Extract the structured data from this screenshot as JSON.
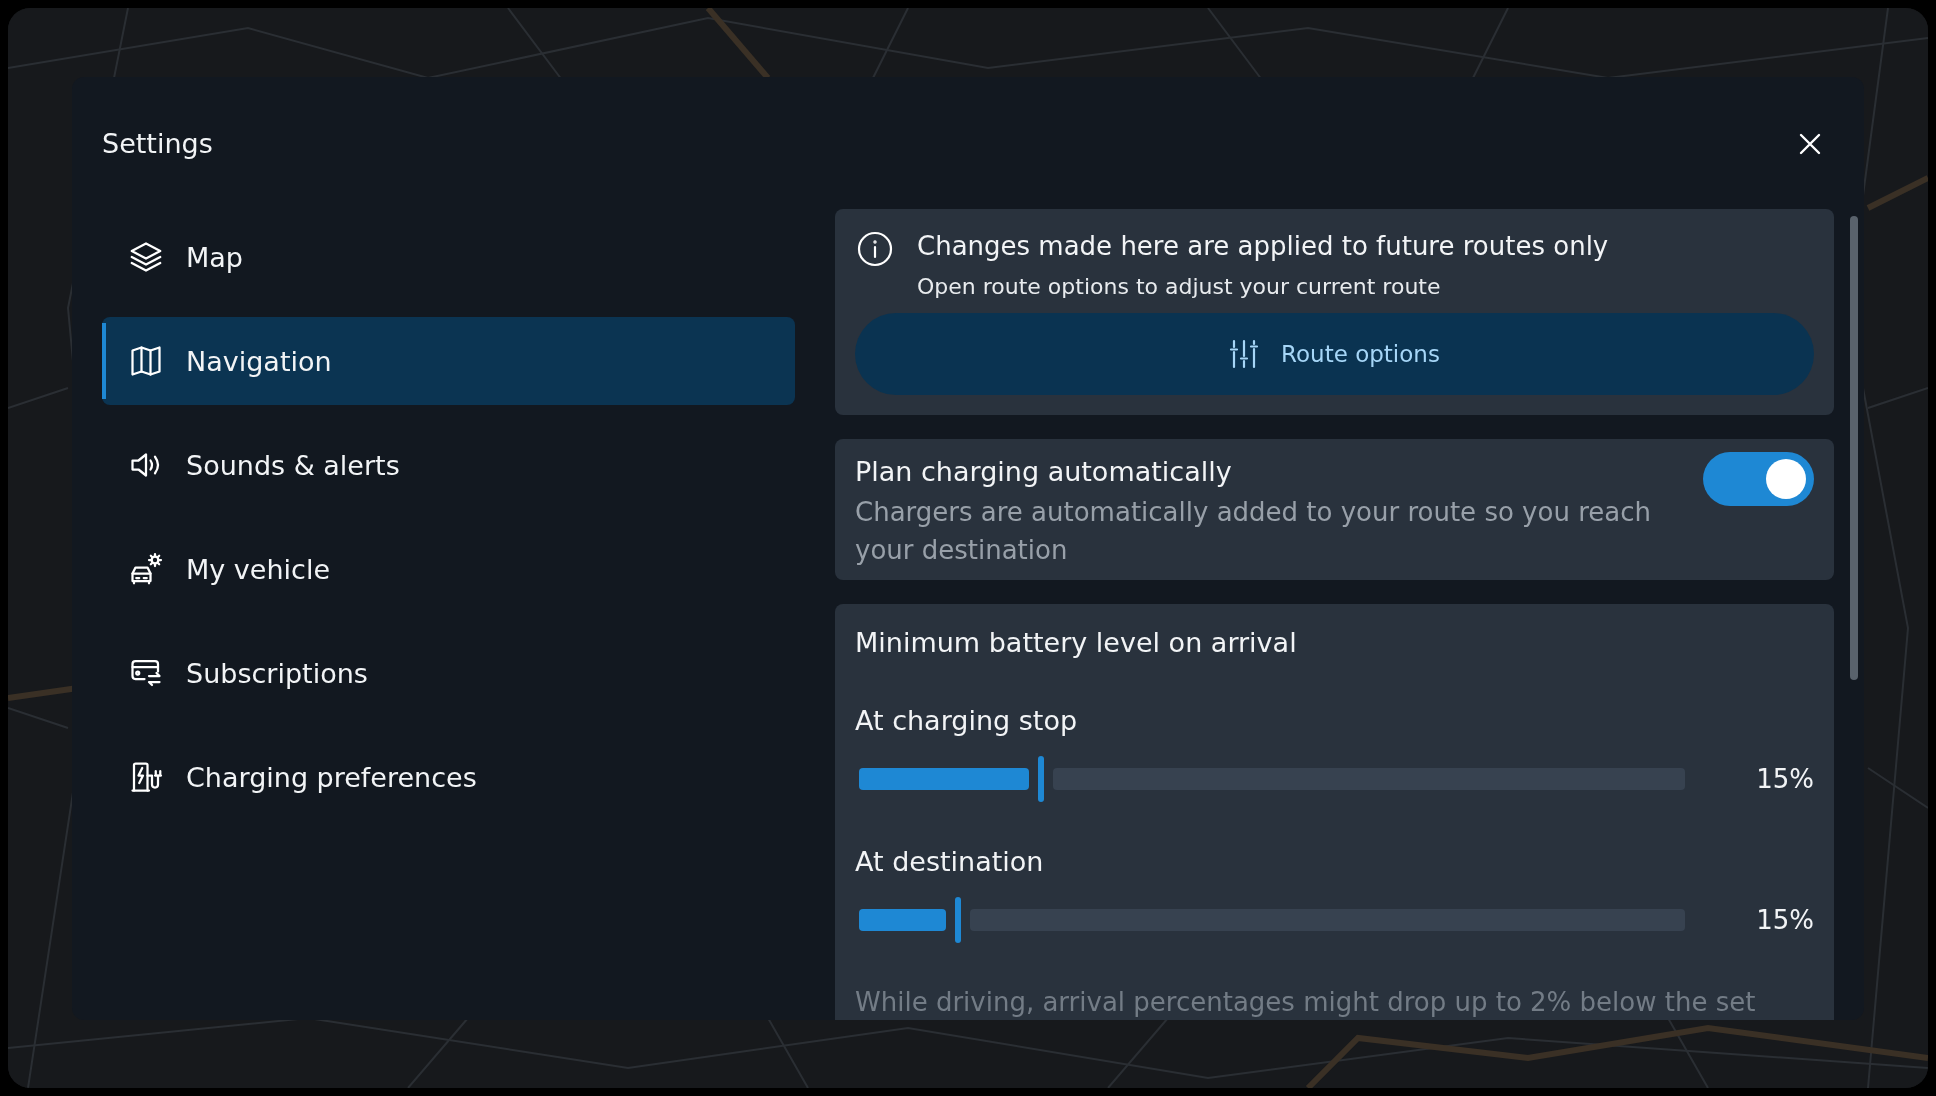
{
  "dialog": {
    "title": "Settings"
  },
  "sidebar": {
    "items": [
      {
        "label": "Map",
        "selected": false
      },
      {
        "label": "Navigation",
        "selected": true
      },
      {
        "label": "Sounds & alerts",
        "selected": false
      },
      {
        "label": "My vehicle",
        "selected": false
      },
      {
        "label": "Subscriptions",
        "selected": false
      },
      {
        "label": "Charging preferences",
        "selected": false
      }
    ]
  },
  "info_card": {
    "title": "Changes made here are applied to future routes only",
    "subtitle": "Open route options to adjust your current route",
    "button": "Route options"
  },
  "charging_card": {
    "title": "Plan charging automatically",
    "description": "Chargers are automatically added to your route so you reach your destination",
    "on": true
  },
  "battery_card": {
    "title": "Minimum battery level on arrival",
    "sliders": [
      {
        "label": "At charging stop",
        "level": 0.22,
        "reading": "15%"
      },
      {
        "label": "At destination",
        "level": 0.12,
        "reading": "15%"
      }
    ],
    "note": "While driving, arrival percentages might drop up to 2% below the set"
  }
}
